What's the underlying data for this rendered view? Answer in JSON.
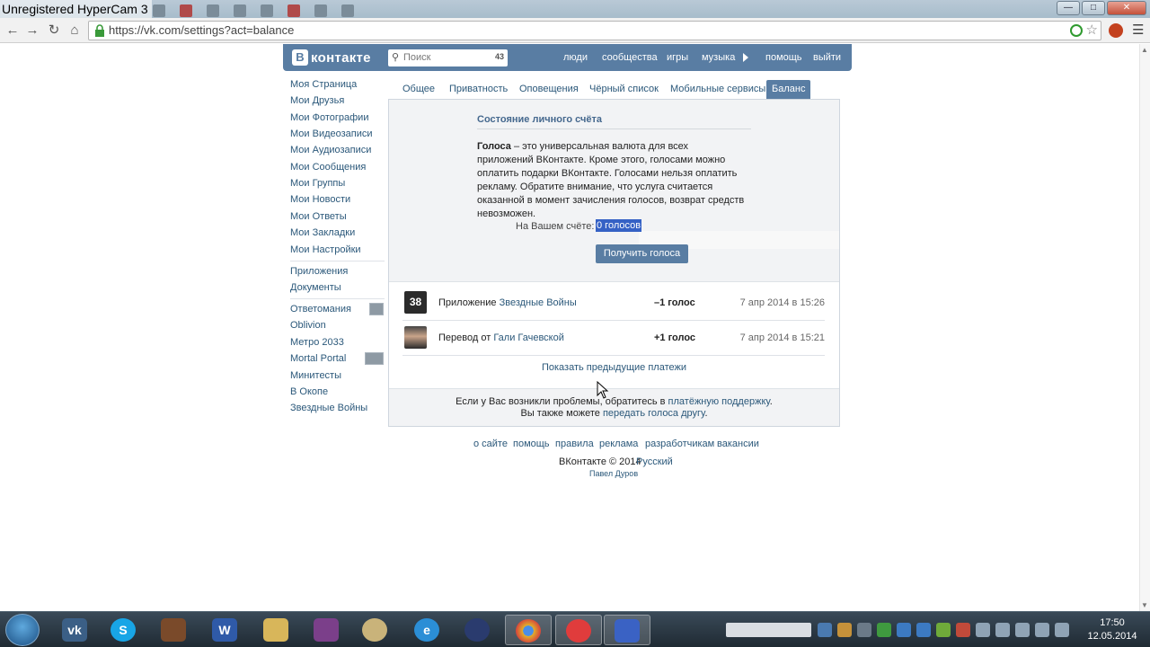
{
  "window": {
    "title": "Unregistered HyperCam 3"
  },
  "browser": {
    "url": "https://vk.com/settings?act=balance"
  },
  "vk": {
    "logo_text": "контакте",
    "logo_letter": "В",
    "search_placeholder": "Поиск",
    "search_count": "43",
    "top_nav": [
      "люди",
      "сообщества",
      "игры",
      "музыка",
      "помощь",
      "выйти"
    ],
    "side_menu": [
      "Моя Страница",
      "Мои Друзья",
      "Мои Фотографии",
      "Мои Видеозаписи",
      "Мои Аудиозаписи",
      "Мои Сообщения",
      "Мои Группы",
      "Мои Новости",
      "Мои Ответы",
      "Мои Закладки",
      "Мои Настройки"
    ],
    "side_menu2": [
      "Приложения",
      "Документы"
    ],
    "side_apps": [
      "Ответомания",
      "Oblivion",
      "Метро 2033",
      "Mortal Portal",
      "Минитесты",
      "В Окопе",
      "Звездные Войны"
    ],
    "tabs": [
      "Общее",
      "Приватность",
      "Оповещения",
      "Чёрный список",
      "Мобильные сервисы",
      "Баланс"
    ],
    "balance": {
      "title": "Состояние личного счёта",
      "desc_bold": "Голоса",
      "desc_rest": " – это универсальная валюта для всех приложений ВКонтакте. Кроме этого, голосами можно оплатить подарки ВКонтакте. Голосами нельзя оплатить рекламу. Обратите внимание, что услуга считается оказанной в момент зачисления голосов, возврат средств невозможен.",
      "account_label": "На Вашем счёте:",
      "account_value": "0 голосов",
      "get_button": "Получить голоса"
    },
    "transactions": [
      {
        "prefix": "Приложение ",
        "link": "Звездные Войны",
        "amount": "–1 голос",
        "date": "7 апр 2014 в 15:26",
        "avatar_text": "38"
      },
      {
        "prefix": "Перевод от ",
        "link": "Гали Гачевской",
        "amount": "+1 голос",
        "date": "7 апр 2014 в 15:21",
        "avatar_text": ""
      }
    ],
    "show_previous": "Показать предыдущие платежи",
    "note": {
      "line1_prefix": "Если у Вас возникли проблемы, обратитесь в ",
      "line1_link": "платёжную поддержку",
      "line1_suffix": ".",
      "line2_prefix": "Вы также можете ",
      "line2_link": "передать голоса другу",
      "line2_suffix": "."
    },
    "footer_links": [
      "о сайте",
      "помощь",
      "правила",
      "реклама",
      "разработчикам",
      "вакансии"
    ],
    "copyright": "ВКонтакте © 2014",
    "language": "Русский",
    "author": "Павел Дуров"
  },
  "taskbar": {
    "time": "17:50",
    "date": "12.05.2014"
  },
  "colors": {
    "vk_blue": "#597da3",
    "link": "#2b587a",
    "selection": "#3561c5"
  }
}
